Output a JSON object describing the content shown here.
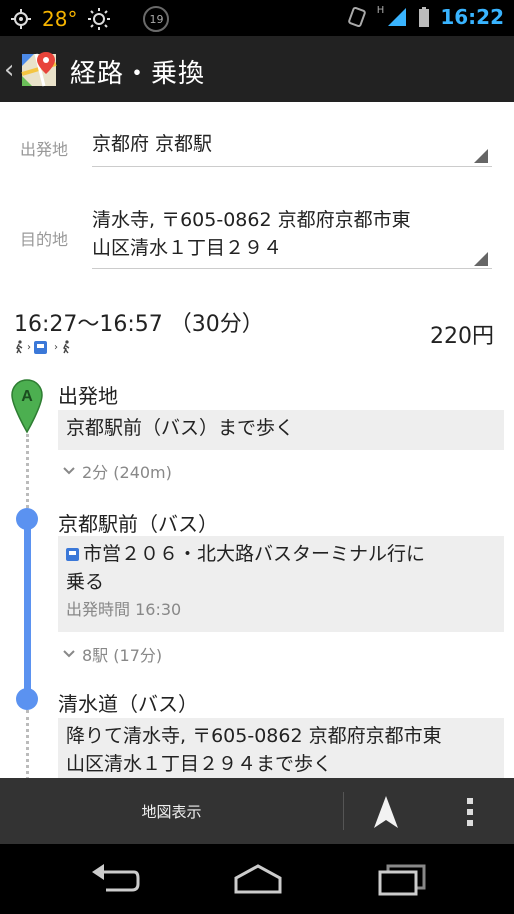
{
  "status_bar": {
    "temperature": "28°",
    "notification_count": "19",
    "network": "H",
    "time": "16:22"
  },
  "action_bar": {
    "title": "経路・乗換"
  },
  "form": {
    "origin": {
      "label": "出発地",
      "value": "京都府 京都駅"
    },
    "destination": {
      "label": "目的地",
      "value_line1": "清水寺, 〒605-0862 京都府京都市東",
      "value_line2": "山区清水１丁目２９４"
    }
  },
  "summary": {
    "time_range": "16:27〜16:57 （30分）",
    "fare": "220円"
  },
  "steps": [
    {
      "marker": "A",
      "title": "出発地",
      "instruction": "京都駅前（バス）まで歩く",
      "meta": "2分 (240m)"
    },
    {
      "title": "京都駅前（バス）",
      "instruction_line1": "市営２０６・北大路バスターミナル行に",
      "instruction_line2": "乗る",
      "departure": "出発時間 16:30",
      "meta": "8駅 (17分)"
    },
    {
      "title": "清水道（バス）",
      "instruction_line1": "降りて清水寺, 〒605-0862 京都府京都市東",
      "instruction_line2": "山区清水１丁目２９４まで歩く"
    }
  ],
  "bottom_bar": {
    "map_button": "地図表示"
  },
  "colors": {
    "route_blue": "#5b92f0",
    "start_green": "#4caf50",
    "clock_blue": "#39b4ff",
    "weather_orange": "#f6b400"
  }
}
